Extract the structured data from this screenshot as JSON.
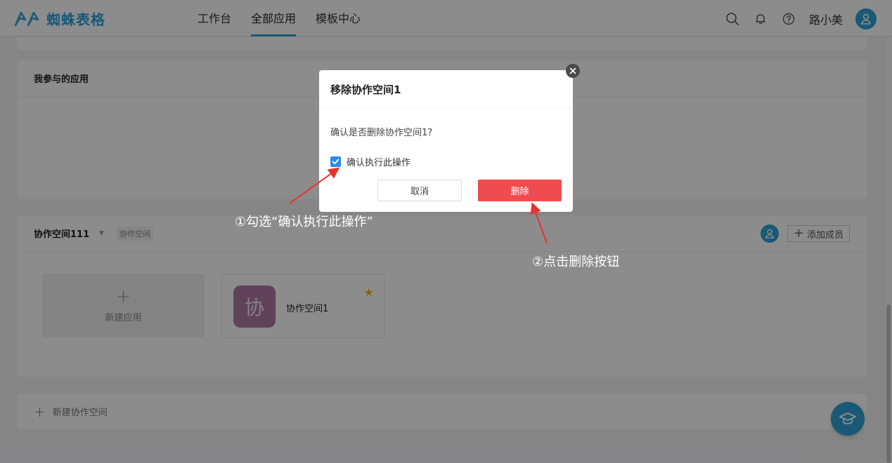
{
  "header": {
    "logo_text": "蜘蛛表格",
    "nav": [
      {
        "label": "工作台"
      },
      {
        "label": "全部应用"
      },
      {
        "label": "模板中心"
      }
    ],
    "active_nav": "全部应用",
    "username": "路小美"
  },
  "sections": {
    "participated_title": "我参与的应用",
    "workspace": {
      "name": "协作空间111",
      "tag": "协作空间",
      "add_member_label": "添加成员",
      "new_app_label": "新建应用",
      "apps": [
        {
          "icon_char": "协",
          "name": "协作空间1",
          "starred": true
        }
      ]
    },
    "new_workspace_label": "新建协作空间"
  },
  "modal": {
    "title": "移除协作空间1",
    "message": "确认是否删除协作空间1?",
    "confirm_label": "确认执行此操作",
    "confirm_checked": true,
    "cancel_label": "取消",
    "delete_label": "删除"
  },
  "annotations": {
    "step1": "①勾选“确认执行此操作”",
    "step2": "②点击删除按钮"
  },
  "colors": {
    "brand": "#2ea3d8",
    "danger": "#ef4c4f",
    "app_icon": "#b07aa6",
    "annotation_arrow": "#e8322c"
  },
  "icons": {
    "search": "search-icon",
    "bell": "bell-icon",
    "help": "help-circle-icon",
    "avatar": "user-icon",
    "close": "close-icon",
    "star": "star-icon",
    "graduation": "graduation-cap-icon"
  }
}
